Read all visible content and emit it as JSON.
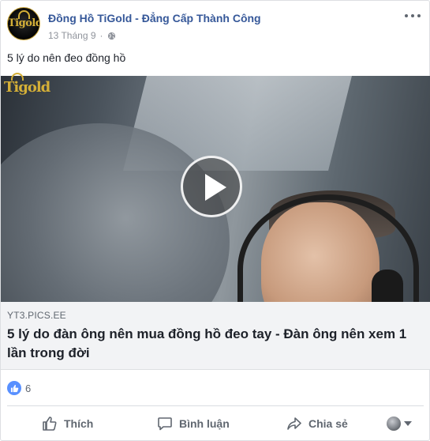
{
  "post": {
    "page_name": "Đồng Hồ TiGold - Đẳng Cấp Thành Công",
    "date": "13 Tháng 9",
    "separator": "·",
    "text": "5 lý do nên đeo đồng hồ",
    "avatar_logo": "Tigold"
  },
  "video": {
    "logo": "Tigold"
  },
  "link_preview": {
    "domain": "YT3.PICS.EE",
    "title": "5 lý do đàn ông nên mua đồng hồ đeo tay - Đàn ông nên xem 1 lần trong đời"
  },
  "reactions": {
    "count": "6",
    "icon": "like-icon"
  },
  "actions": {
    "like": "Thích",
    "comment": "Bình luận",
    "share": "Chia sẻ"
  },
  "colors": {
    "link_blue": "#365899",
    "like_blue": "#5890ff",
    "muted": "#606770",
    "gold": "#d4af37"
  }
}
